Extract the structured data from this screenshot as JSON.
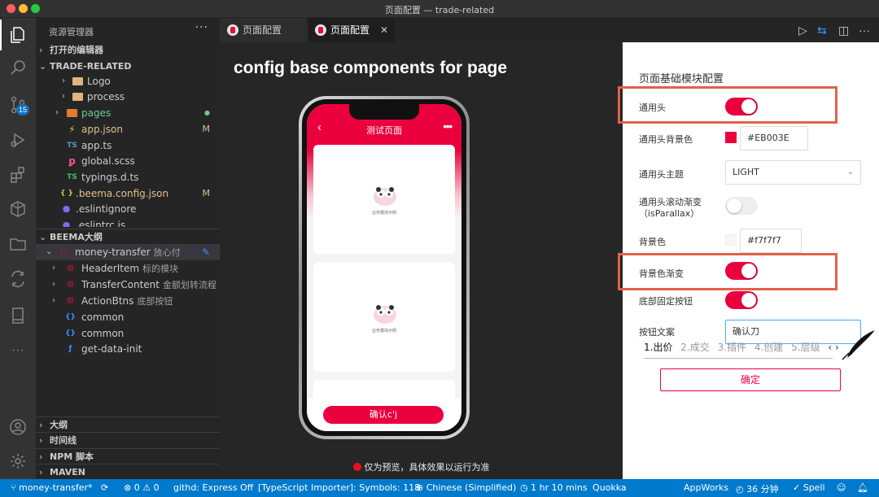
{
  "window": {
    "title": "页面配置 — trade-related"
  },
  "activity": {
    "badge": "15"
  },
  "sidebar": {
    "header": "资源管理器",
    "sections": {
      "open_editors": "打开的编辑器",
      "workspace": "TRADE-RELATED",
      "outline": "BEEMA大纲",
      "tree2": "大纲",
      "timeline": "时间线",
      "npm": "NPM 脚本",
      "maven": "MAVEN"
    },
    "files": [
      {
        "name": "Logo",
        "mark": ""
      },
      {
        "name": "process",
        "mark": ""
      },
      {
        "name": "pages",
        "mark": "●"
      },
      {
        "name": "app.json",
        "mark": "M"
      },
      {
        "name": "app.ts",
        "mark": ""
      },
      {
        "name": "global.scss",
        "mark": ""
      },
      {
        "name": "typings.d.ts",
        "mark": ""
      },
      {
        "name": ".beema.config.json",
        "mark": "M"
      },
      {
        "name": ".eslintignore",
        "mark": ""
      },
      {
        "name": ".eslintrc.js",
        "mark": ""
      }
    ],
    "outline_items": [
      {
        "name": "money-transfer",
        "sub": "放心付"
      },
      {
        "name": "HeaderItem",
        "sub": "标的模块"
      },
      {
        "name": "TransferContent",
        "sub": "金额划转流程"
      },
      {
        "name": "ActionBtns",
        "sub": "底部按钮"
      },
      {
        "name": "common",
        "sub": ""
      },
      {
        "name": "common",
        "sub": ""
      },
      {
        "name": "get-data-init",
        "sub": ""
      }
    ]
  },
  "tabs": [
    {
      "label": "页面配置"
    },
    {
      "label": "页面配置"
    }
  ],
  "preview": {
    "heading": "config base components for page",
    "screen_title": "测试页面",
    "card_caption": "业务模块示例",
    "confirm_button": "确认c'j",
    "note": "仅为预览，具体效果以运行为准"
  },
  "panel": {
    "title": "页面基础模块配置",
    "header_label": "通用头",
    "header_on": true,
    "header_bg_label": "通用头背景色",
    "header_bg_value": "#EB003E",
    "header_bg_color": "#EB003E",
    "theme_label": "通用头主题",
    "theme_value": "LIGHT",
    "parallax_label": "通用头滚动渐变",
    "parallax_sub": "（isParallax）",
    "parallax_on": false,
    "bg_label": "背景色",
    "bg_value": "#f7f7f7",
    "bg_color": "#f7f7f7",
    "gradient_label": "背景色渐变",
    "gradient_on": true,
    "fixed_btn_label": "底部固定按钮",
    "fixed_btn_on": true,
    "btn_text_label": "按钮文案",
    "btn_text_value": "确认刀",
    "ime_candidates": [
      "1.出价",
      "2.成交",
      "3.插件",
      "4.创建",
      "5.层级"
    ],
    "submit": "确定",
    "accent_color": "#EB003E"
  },
  "statusbar": {
    "branch": "money-transfer*",
    "problems": "⊗ 0 ⚠ 0",
    "githd": "githd: Express Off",
    "ts_importer": "[TypeScript Importer]: Symbols: 118",
    "language": "Chinese (Simplified)",
    "time": "1 hr 10 mins",
    "quokka": "Quokka",
    "appworks": "AppWorks",
    "duration": "36 分钟",
    "spell": "Spell"
  }
}
